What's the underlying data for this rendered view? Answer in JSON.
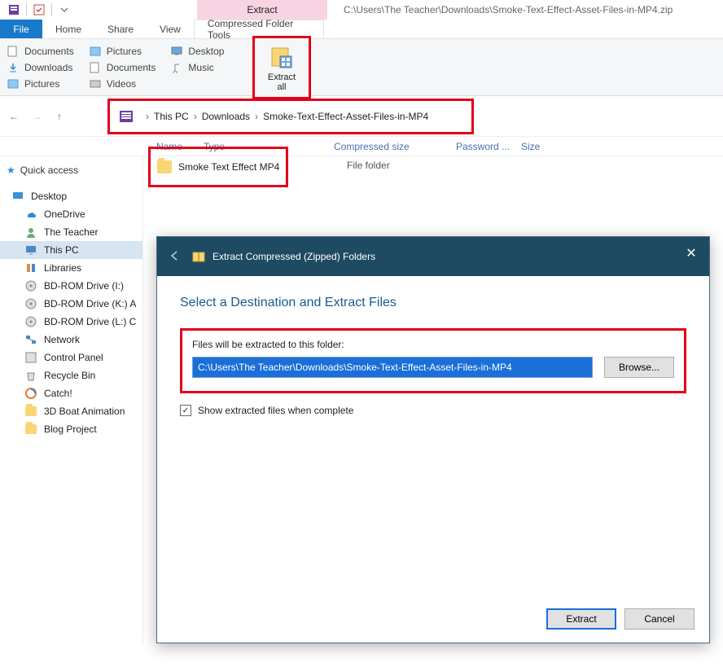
{
  "window": {
    "path_title": "C:\\Users\\The Teacher\\Downloads\\Smoke-Text-Effect-Asset-Files-in-MP4.zip",
    "context_tab_group": "Extract",
    "context_tab": "Compressed Folder Tools"
  },
  "tabs": {
    "file": "File",
    "home": "Home",
    "share": "Share",
    "view": "View"
  },
  "ribbon": {
    "destinations_col1": [
      "Documents",
      "Downloads",
      "Pictures"
    ],
    "destinations_col2": [
      "Pictures",
      "Documents",
      "Videos"
    ],
    "destinations_col3": [
      "Desktop",
      "Music"
    ],
    "extract_all": "Extract\nall"
  },
  "breadcrumb": {
    "segments": [
      "This PC",
      "Downloads",
      "Smoke-Text-Effect-Asset-Files-in-MP4"
    ]
  },
  "columns": {
    "name": "Name",
    "type": "Type",
    "compressed": "Compressed size",
    "password": "Password ...",
    "size": "Size"
  },
  "sidebar": {
    "quick_access": "Quick access",
    "desktop": "Desktop",
    "items": [
      "OneDrive",
      "The Teacher",
      "This PC",
      "Libraries",
      "BD-ROM Drive (I:)",
      "BD-ROM Drive (K:) A",
      "BD-ROM Drive (L:) C",
      "Network",
      "Control Panel",
      "Recycle Bin",
      "Catch!",
      "3D Boat Animation",
      "Blog Project"
    ]
  },
  "file_list": {
    "rows": [
      {
        "name": "Smoke Text Effect MP4",
        "type": "File folder"
      }
    ]
  },
  "dialog": {
    "title": "Extract Compressed (Zipped) Folders",
    "heading": "Select a Destination and Extract Files",
    "dest_label": "Files will be extracted to this folder:",
    "dest_value": "C:\\Users\\The Teacher\\Downloads\\Smoke-Text-Effect-Asset-Files-in-MP4",
    "browse": "Browse...",
    "show_when_complete": "Show extracted files when complete",
    "checked": "☑",
    "extract": "Extract",
    "cancel": "Cancel"
  }
}
